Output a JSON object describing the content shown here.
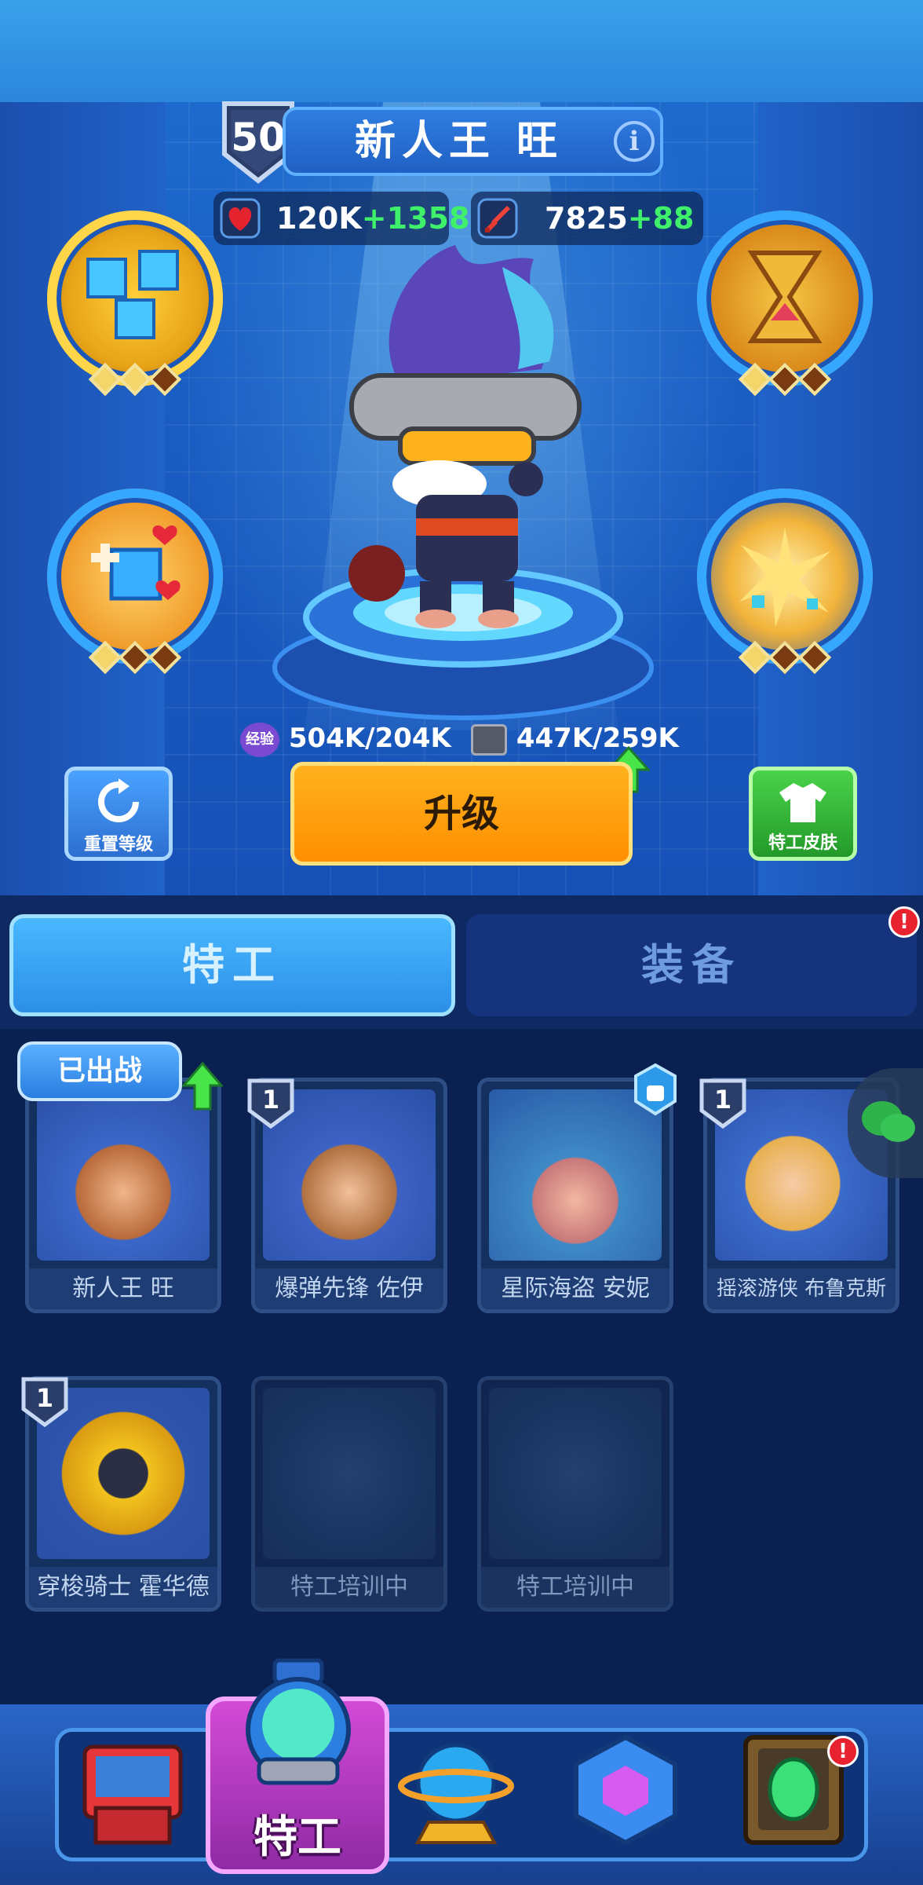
{
  "hero": {
    "level": "50",
    "name": "新人王 旺",
    "info_icon": "i",
    "hp": "120K",
    "hp_bonus": "+1358",
    "atk": "7825",
    "atk_bonus": "+88",
    "exp_label": "经验",
    "exp": "504K/204K",
    "parts": "447K/259K"
  },
  "buttons": {
    "reset": "重置等级",
    "upgrade": "升级",
    "skin": "特工皮肤"
  },
  "tabs": [
    {
      "label": "特工"
    },
    {
      "label": "装备",
      "alert": "!"
    }
  ],
  "status_bubble": "已出战",
  "agents": [
    {
      "name": "新人王 旺",
      "level": "",
      "deployed": true
    },
    {
      "name": "爆弹先锋 佐伊",
      "level": "1"
    },
    {
      "name": "星际海盗 安妮",
      "locked_badge": true
    },
    {
      "name": "摇滚游侠 布鲁克斯",
      "level": "1"
    },
    {
      "name": "穿梭骑士 霍华德",
      "level": "1"
    },
    {
      "name": "特工培训中",
      "locked": true
    },
    {
      "name": "特工培训中",
      "locked": true
    }
  ],
  "nav": {
    "active_label": "特工",
    "alert": "!"
  },
  "colors": {
    "accent_orange": "#ff9800",
    "green_bonus": "#3ff06b",
    "active_nav": "#c23fd0"
  }
}
